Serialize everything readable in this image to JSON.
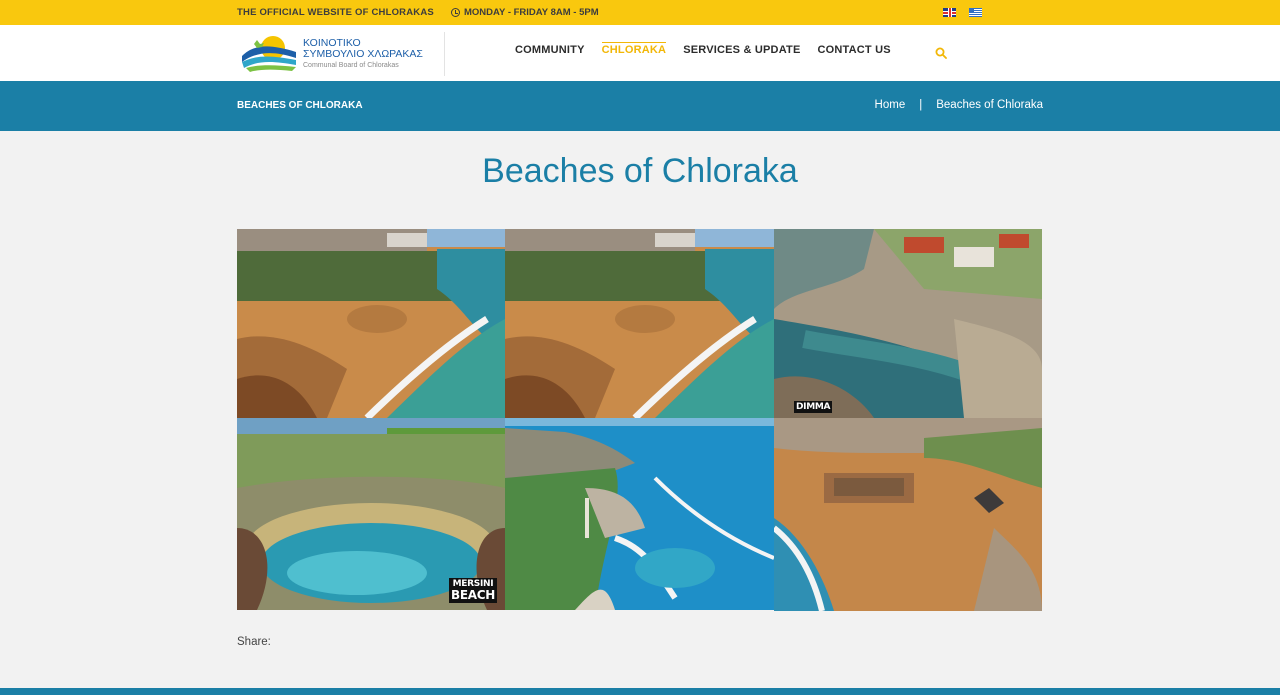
{
  "topbar": {
    "official": "THE OFFICIAL WEBSITE OF CHLORAKAS",
    "hours": "MONDAY - FRIDAY 8AM - 5PM",
    "languages": [
      "uk-flag-icon",
      "greek-flag-icon"
    ]
  },
  "header": {
    "logo_line1": "ΚΟΙΝΟΤΙΚΟ",
    "logo_line2": "ΣΥΜΒΟΥΛΙΟ ΧΛΩΡΑΚΑΣ",
    "logo_line3": "Communal Board of Chlorakas",
    "nav": [
      {
        "label": "COMMUNITY"
      },
      {
        "label": "CHLORAKA",
        "active": true
      },
      {
        "label": "SERVICES & UPDATE"
      },
      {
        "label": "CONTACT US"
      }
    ],
    "search_icon": "search-icon"
  },
  "banner": {
    "page_name": "BEACHES OF CHLORAKA",
    "breadcrumb_home": "Home",
    "breadcrumb_sep": "|",
    "breadcrumb_current": "Beaches of Chloraka"
  },
  "main": {
    "title": "Beaches of Chloraka",
    "gallery_labels": {
      "dimma": "DIMMA",
      "mersini_1": "MERSINI",
      "mersini_2": "BEACH"
    },
    "share_label": "Share:"
  },
  "colors": {
    "topbar": "#f9c80e",
    "accent_blue": "#1b7fa6",
    "nav_active": "#f2b707"
  }
}
